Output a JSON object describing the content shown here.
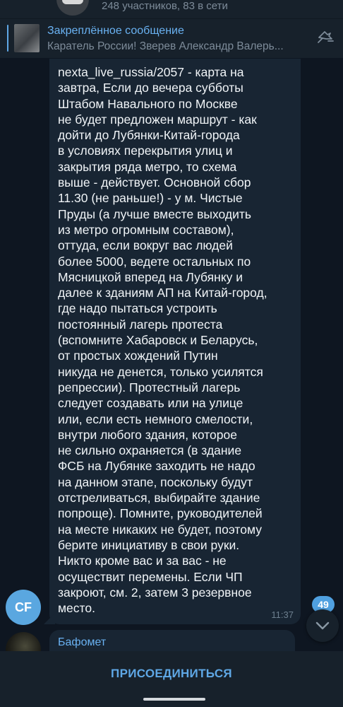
{
  "header": {
    "subtitle": "248 участников, 83 в сети"
  },
  "pinned": {
    "title": "Закреплённое сообщение",
    "text": "Каратель России!  Зверев Александр Валерь...",
    "unpin_icon": "unpin-icon"
  },
  "message": {
    "text": "nexta_live_russia/2057 - карта на\nзавтра, Если до вечера субботы\nШтабом Навального по Москве\nне будет предложен маршрут - как\nдойти до Лубянки-Китай-города\nв условиях перекрытия улиц и\nзакрытия ряда метро, то схема\nвыше - действует. Основной сбор\n11.30 (не раньше!) - у м. Чистые\nПруды (а лучше вместе выходить\nиз метро огромным составом),\nоттуда, если вокруг вас людей\nболее 5000, ведете остальных по\nМясницкой вперед на Лубянку и\nдалее к зданиям АП на Китай-город,\nгде надо пытаться устроить\nпостоянный лагерь протеста\n(вспомните Хабаровск и Беларусь,\nот простых хождений Путин\nникуда не денется, только усилятся\nрепрессии). Протестный лагерь\nследует создавать или на улице\nили, если есть немного смелости,\nвнутри любого здания, которое\nне сильно охраняется (в здание\nФСБ на Лубянке заходить не надо\nна данном этапе, поскольку будут\nотстреливаться, выбирайте здание\nпопроще). Помните, руководителей\nна месте никаких не будет, поэтому\nберите инициативу в свои руки.\nНикто кроме вас и за вас - не\nосуществит перемены. Если ЧП\nзакроют, см. 2, затем 3 резервное\nместо.",
    "time": "11:37",
    "sender_initials": "CF"
  },
  "next_message": {
    "sender_name": "Бафомет"
  },
  "scroll": {
    "unread_count": "49",
    "icon": "chevron-down-icon"
  },
  "footer": {
    "join_label": "ПРИСОЕДИНИТЬСЯ"
  },
  "colors": {
    "background": "#0e1621",
    "bubble": "#182533",
    "accent": "#5fa8e6",
    "avatar_cf": "#5aa7e0"
  }
}
